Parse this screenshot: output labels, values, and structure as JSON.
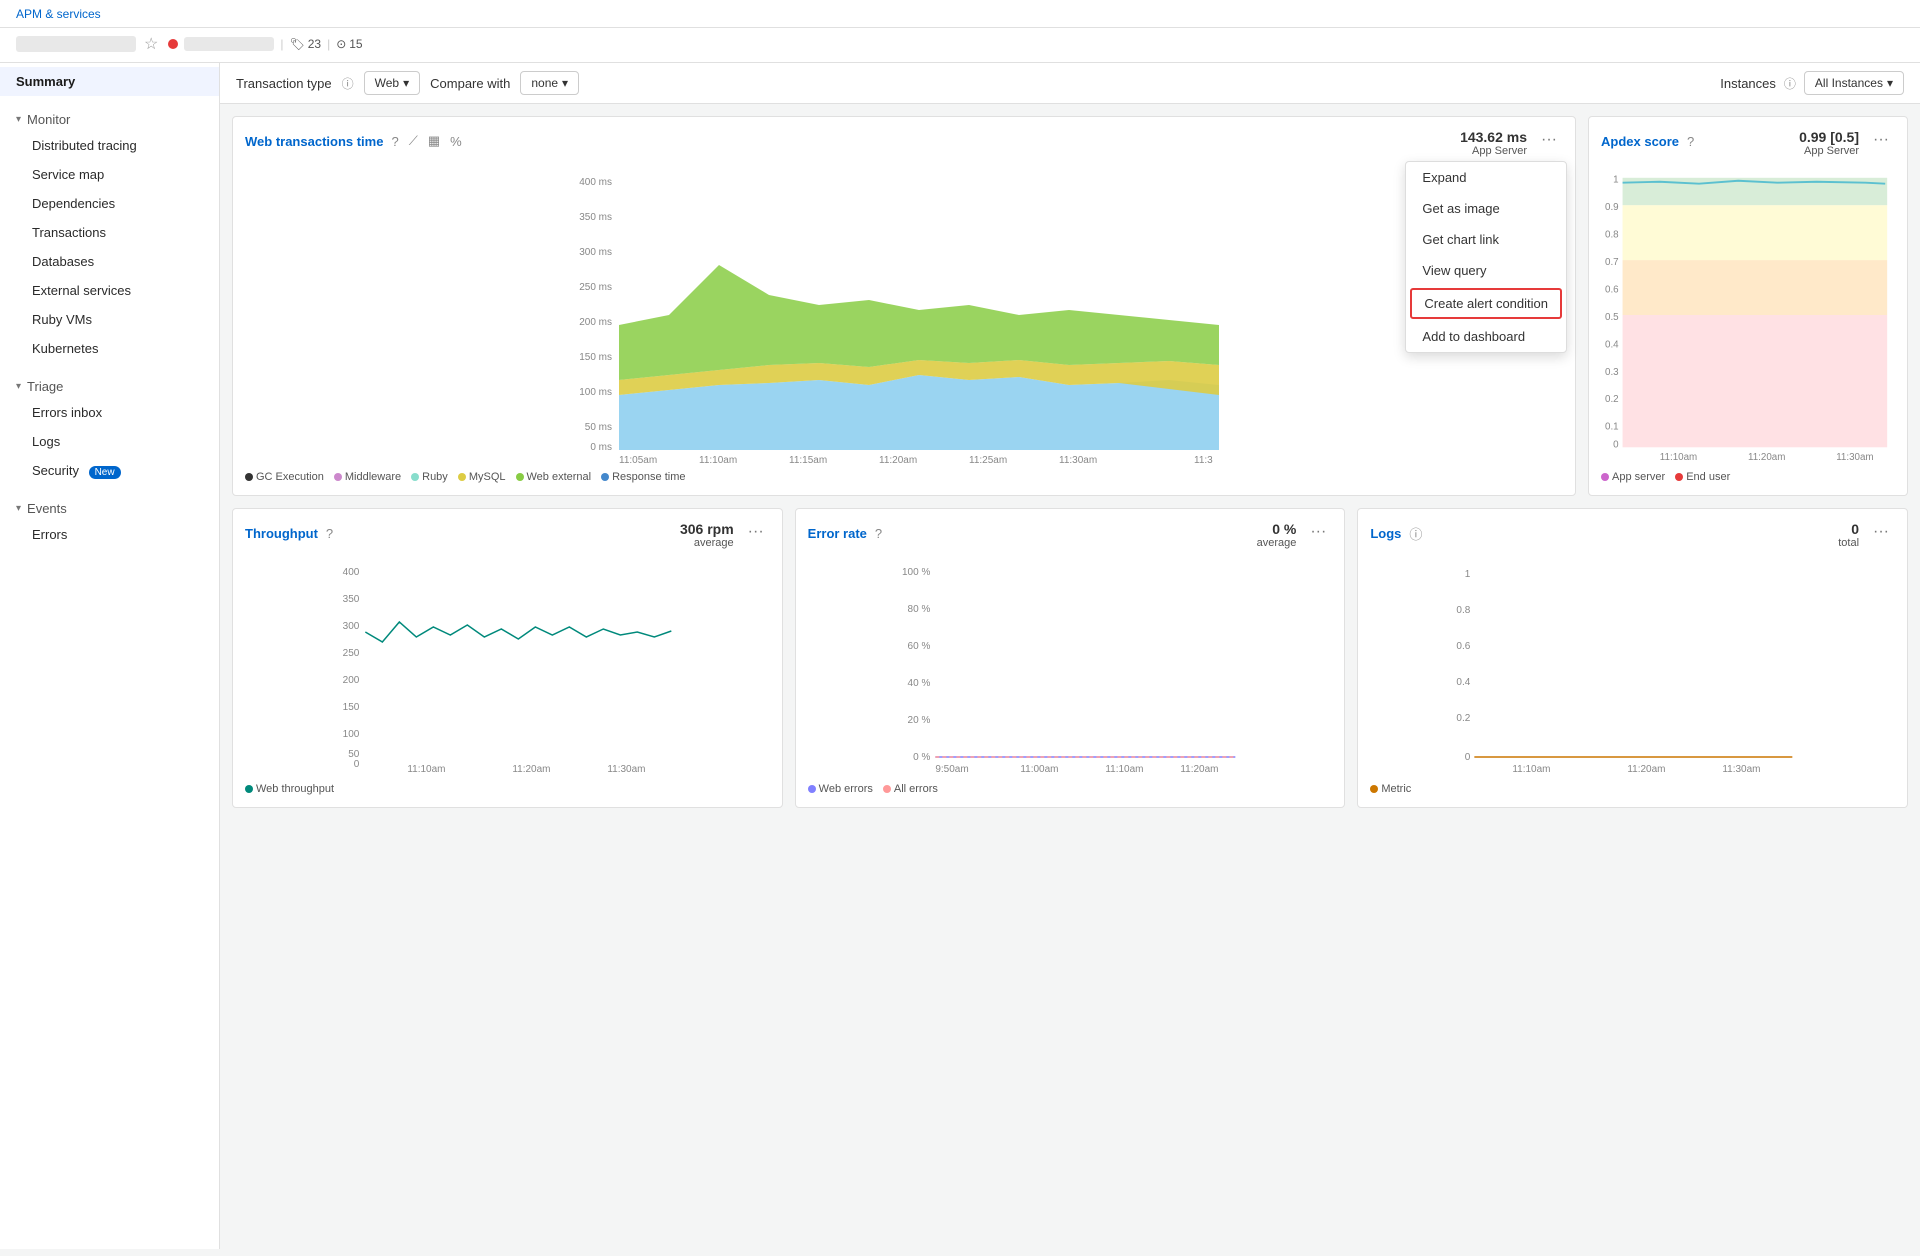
{
  "nav": {
    "breadcrumb": "APM & services"
  },
  "service": {
    "star_icon": "☆",
    "tags_count": "23",
    "instances_count": "15"
  },
  "toolbar": {
    "transaction_type_label": "Transaction type",
    "transaction_type_value": "Web",
    "compare_with_label": "Compare with",
    "compare_with_value": "none",
    "instances_label": "Instances",
    "instances_value": "All Instances"
  },
  "web_transactions": {
    "title": "Web transactions time",
    "value": "143.62 ms",
    "subtitle": "App Server",
    "y_labels": [
      "400 ms",
      "350 ms",
      "300 ms",
      "250 ms",
      "200 ms",
      "150 ms",
      "100 ms",
      "50 ms",
      "0 ms"
    ],
    "x_labels": [
      "11:05am",
      "11:10am",
      "11:15am",
      "11:20am",
      "11:25am",
      "11:30am",
      "11:3"
    ],
    "legend": [
      {
        "label": "GC Execution",
        "color": "#333333"
      },
      {
        "label": "Middleware",
        "color": "#cc88cc"
      },
      {
        "label": "Ruby",
        "color": "#88ddcc"
      },
      {
        "label": "MySQL",
        "color": "#ddcc44"
      },
      {
        "label": "Web external",
        "color": "#88cc44"
      },
      {
        "label": "Response time",
        "color": "#4488cc"
      }
    ]
  },
  "dropdown_menu": {
    "items": [
      "Expand",
      "Get as image",
      "Get chart link",
      "View query",
      "Create alert condition",
      "Add to dashboard"
    ]
  },
  "apdex": {
    "title": "Apdex score",
    "value": "0.99 [0.5]",
    "subtitle": "App Server",
    "y_labels": [
      "1",
      "0.9",
      "0.8",
      "0.7",
      "0.6",
      "0.5",
      "0.4",
      "0.3",
      "0.2",
      "0.1",
      "0"
    ],
    "x_labels": [
      "11:10am",
      "11:20am",
      "11:30am"
    ],
    "legend": [
      {
        "label": "App server",
        "color": "#cc66cc"
      },
      {
        "label": "End user",
        "color": "#e63a3a"
      }
    ]
  },
  "throughput": {
    "title": "Throughput",
    "value": "306 rpm",
    "subtitle": "average",
    "y_labels": [
      "400",
      "350",
      "300",
      "250",
      "200",
      "150",
      "100",
      "50",
      "0"
    ],
    "x_labels": [
      "11:10am",
      "11:20am",
      "11:30am"
    ],
    "legend": [
      {
        "label": "Web throughput",
        "color": "#00897b"
      }
    ]
  },
  "error_rate": {
    "title": "Error rate",
    "value": "0 %",
    "subtitle": "average",
    "y_labels": [
      "100 %",
      "80 %",
      "60 %",
      "40 %",
      "20 %",
      "0 %"
    ],
    "x_labels": [
      "9:50am",
      "11:00am",
      "11:10am",
      "11:20am"
    ],
    "legend": [
      {
        "label": "Web errors",
        "color": "#8080ff"
      },
      {
        "label": "All errors",
        "color": "#ff9999"
      }
    ]
  },
  "logs": {
    "title": "Logs",
    "value": "0",
    "subtitle": "total",
    "y_labels": [
      "1",
      "0.8",
      "0.6",
      "0.4",
      "0.2",
      "0"
    ],
    "x_labels": [
      "11:10am",
      "11:20am",
      "11:30am"
    ],
    "legend": [
      {
        "label": "Metric",
        "color": "#cc7700"
      }
    ]
  },
  "sidebar": {
    "summary_label": "Summary",
    "monitor_label": "Monitor",
    "monitor_items": [
      "Distributed tracing",
      "Service map",
      "Dependencies",
      "Transactions",
      "Databases",
      "External services",
      "Ruby VMs",
      "Kubernetes"
    ],
    "triage_label": "Triage",
    "triage_items": [
      "Errors inbox",
      "Logs",
      "Security"
    ],
    "security_new": "New",
    "events_label": "Events",
    "events_items": [
      "Errors"
    ]
  },
  "icons": {
    "chevron_down": "▾",
    "info": "ⓘ",
    "question": "?",
    "more": "···",
    "line_chart": "⟋",
    "bar_chart": "▦",
    "percent": "%"
  }
}
